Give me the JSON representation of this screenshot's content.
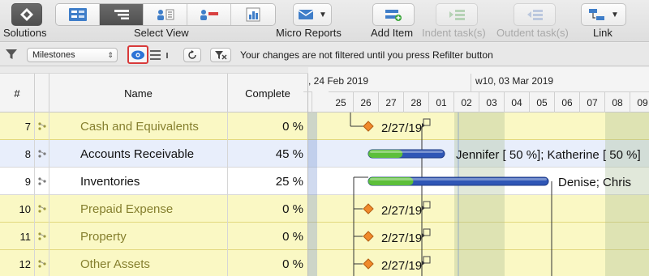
{
  "toolbar": {
    "solutions_label": "Solutions",
    "select_view_label": "Select View",
    "micro_reports_label": "Micro Reports",
    "add_item_label": "Add Item",
    "indent_label": "Indent task(s)",
    "outdent_label": "Outdent task(s)",
    "link_label": "Link"
  },
  "filterbar": {
    "filter_value": "Milestones",
    "message": "Your changes are not filtered until you press Refilter button"
  },
  "table": {
    "headers": {
      "num": "#",
      "name": "Name",
      "complete": "Complete"
    },
    "rows": [
      {
        "num": "7",
        "name": "Cash and Equivalents",
        "complete": "0 %",
        "kind": "milestone"
      },
      {
        "num": "8",
        "name": "Accounts Receivable",
        "complete": "45 %",
        "kind": "selected"
      },
      {
        "num": "9",
        "name": "Inventories",
        "complete": "25 %",
        "kind": "task"
      },
      {
        "num": "10",
        "name": "Prepaid Expense",
        "complete": "0 %",
        "kind": "milestone"
      },
      {
        "num": "11",
        "name": "Property",
        "complete": "0 %",
        "kind": "milestone"
      },
      {
        "num": "12",
        "name": "Other Assets",
        "complete": "0 %",
        "kind": "milestone"
      }
    ]
  },
  "gantt": {
    "week_labels": [
      ", 24 Feb 2019",
      "w10, 03 Mar 2019"
    ],
    "days": [
      "",
      "25",
      "26",
      "27",
      "28",
      "01",
      "02",
      "03",
      "04",
      "05",
      "06",
      "07",
      "08",
      "09"
    ],
    "milestone_date": "2/27/19",
    "row8_resources": "Jennifer [ 50 %]; Katherine [ 50 %]",
    "row9_resources": "Denise; Chris",
    "row8_progress": 0.45,
    "row9_progress": 0.25
  },
  "colors": {
    "milestone_row": "#faf8c4",
    "selected_row": "#e8eefb",
    "bar_blue": "#2f56b6",
    "bar_green": "#5cbf3a",
    "diamond": "#f08a2c",
    "eye_border": "#d83a3a"
  }
}
